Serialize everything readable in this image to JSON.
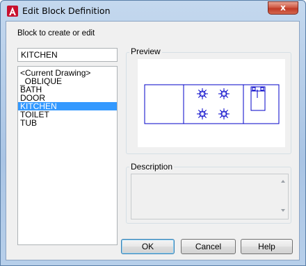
{
  "window": {
    "title": "Edit Block Definition",
    "close_label": "x"
  },
  "block": {
    "label": "Block to create or edit",
    "input_value": "KITCHEN",
    "items": [
      "<Current Drawing>",
      "_OBLIQUE",
      "BATH",
      "DOOR",
      "KITCHEN",
      "TOILET",
      "TUB"
    ],
    "selected_index": 4
  },
  "preview": {
    "label": "Preview"
  },
  "description": {
    "label": "Description",
    "text": ""
  },
  "buttons": {
    "ok": "OK",
    "cancel": "Cancel",
    "help": "Help"
  },
  "colors": {
    "accent": "#3399ff",
    "drawing": "#0000c8",
    "close": "#c8402a"
  }
}
